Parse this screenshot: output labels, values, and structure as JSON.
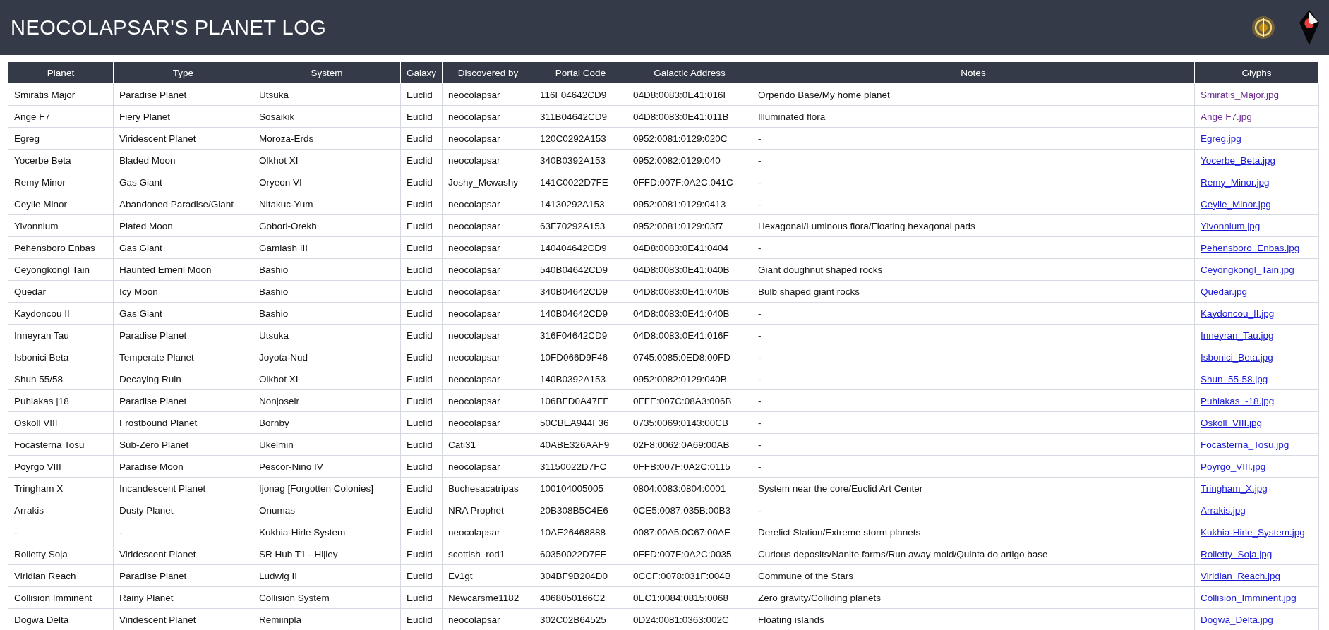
{
  "header": {
    "title": "NEOCOLAPSAR'S PLANET LOG"
  },
  "table": {
    "columns": [
      "Planet",
      "Type",
      "System",
      "Galaxy",
      "Discovered by",
      "Portal Code",
      "Galactic Address",
      "Notes",
      "Glyphs"
    ],
    "rows": [
      {
        "cells": [
          "Smiratis Major",
          "Paradise Planet",
          "Utsuka",
          "Euclid",
          "neocolapsar",
          "116F04642CD9",
          "04D8:0083:0E41:016F",
          "Orpendo Base/My home planet"
        ],
        "glyphs": "Smiratis_Major.jpg",
        "visited": true
      },
      {
        "cells": [
          "Ange F7",
          "Fiery Planet",
          "Sosaikik",
          "Euclid",
          "neocolapsar",
          "311B04642CD9",
          "04D8:0083:0E41:011B",
          "Illuminated flora"
        ],
        "glyphs": "Ange F7.jpg",
        "visited": true
      },
      {
        "cells": [
          "Egreg",
          "Viridescent Planet",
          "Moroza-Erds",
          "Euclid",
          "neocolapsar",
          "120C0292A153",
          "0952:0081:0129:020C",
          "-"
        ],
        "glyphs": "Egreg.jpg",
        "visited": false
      },
      {
        "cells": [
          "Yocerbe Beta",
          "Bladed Moon",
          "Olkhot XI",
          "Euclid",
          "neocolapsar",
          "340B0392A153",
          "0952:0082:0129:040",
          "-"
        ],
        "glyphs": "Yocerbe_Beta.jpg",
        "visited": false
      },
      {
        "cells": [
          "Remy Minor",
          "Gas Giant",
          "Oryeon VI",
          "Euclid",
          "Joshy_Mcwashy",
          "141C0022D7FE",
          "0FFD:007F:0A2C:041C",
          "-"
        ],
        "glyphs": "Remy_Minor.jpg",
        "visited": false
      },
      {
        "cells": [
          "Ceylle Minor",
          "Abandoned Paradise/Giant",
          "Nitakuc-Yum",
          "Euclid",
          "neocolapsar",
          "14130292A153",
          "0952:0081:0129:0413",
          "-"
        ],
        "glyphs": "Ceylle_Minor.jpg",
        "visited": false
      },
      {
        "cells": [
          "Yivonnium",
          "Plated Moon",
          "Gobori-Orekh",
          "Euclid",
          "neocolapsar",
          "63F70292A153",
          "0952:0081:0129:03f7",
          "Hexagonal/Luminous flora/Floating hexagonal pads"
        ],
        "glyphs": "Yivonnium.jpg",
        "visited": false
      },
      {
        "cells": [
          "Pehensboro Enbas",
          "Gas Giant",
          "Gamiash III",
          "Euclid",
          "neocolapsar",
          "140404642CD9",
          "04D8:0083:0E41:0404",
          "-"
        ],
        "glyphs": "Pehensboro_Enbas.jpg",
        "visited": false
      },
      {
        "cells": [
          "Ceyongkongl Tain",
          "Haunted Emeril Moon",
          "Bashio",
          "Euclid",
          "neocolapsar",
          "540B04642CD9",
          "04D8:0083:0E41:040B",
          "Giant doughnut shaped rocks"
        ],
        "glyphs": "Ceyongkongl_Tain.jpg",
        "visited": false
      },
      {
        "cells": [
          "Quedar",
          "Icy Moon",
          "Bashio",
          "Euclid",
          "neocolapsar",
          "340B04642CD9",
          "04D8:0083:0E41:040B",
          "Bulb shaped giant rocks"
        ],
        "glyphs": "Quedar.jpg",
        "visited": false
      },
      {
        "cells": [
          "Kaydoncou II",
          "Gas Giant",
          "Bashio",
          "Euclid",
          "neocolapsar",
          "140B04642CD9",
          "04D8:0083:0E41:040B",
          "-"
        ],
        "glyphs": "Kaydoncou_II.jpg",
        "visited": false
      },
      {
        "cells": [
          "Inneyran Tau",
          "Paradise Planet",
          "Utsuka",
          "Euclid",
          "neocolapsar",
          "316F04642CD9",
          "04D8:0083:0E41:016F",
          "-"
        ],
        "glyphs": "Inneyran_Tau.jpg",
        "visited": false
      },
      {
        "cells": [
          "Isbonici Beta",
          "Temperate Planet",
          "Joyota-Nud",
          "Euclid",
          "neocolapsar",
          "10FD066D9F46",
          "0745:0085:0ED8:00FD",
          "-"
        ],
        "glyphs": "Isbonici_Beta.jpg",
        "visited": false
      },
      {
        "cells": [
          "Shun 55/58",
          "Decaying Ruin",
          "Olkhot XI",
          "Euclid",
          "neocolapsar",
          "140B0392A153",
          "0952:0082:0129:040B",
          "-"
        ],
        "glyphs": "Shun_55-58.jpg",
        "visited": false
      },
      {
        "cells": [
          "Puhiakas |18",
          "Paradise Planet",
          "Nonjoseir",
          "Euclid",
          "neocolapsar",
          "106BFD0A47FF",
          "0FFE:007C:08A3:006B",
          "-"
        ],
        "glyphs": "Puhiakas_-18.jpg",
        "visited": false
      },
      {
        "cells": [
          "Oskoll VIII",
          "Frostbound Planet",
          "Bornby",
          "Euclid",
          "neocolapsar",
          "50CBEA944F36",
          "0735:0069:0143:00CB",
          "-"
        ],
        "glyphs": "Oskoll_VIII.jpg",
        "visited": false
      },
      {
        "cells": [
          "Focasterna Tosu",
          "Sub-Zero Planet",
          "Ukelmin",
          "Euclid",
          "Cati31",
          "40ABE326AAF9",
          "02F8:0062:0A69:00AB",
          "-"
        ],
        "glyphs": "Focasterna_Tosu.jpg",
        "visited": false
      },
      {
        "cells": [
          "Poyrgo VIII",
          "Paradise Moon",
          "Pescor-Nino IV",
          "Euclid",
          "neocolapsar",
          "31150022D7FC",
          "0FFB:007F:0A2C:0115",
          "-"
        ],
        "glyphs": "Poyrgo_VIII.jpg",
        "visited": false
      },
      {
        "cells": [
          "Tringham X",
          "Incandescent Planet",
          "Ijonag [Forgotten Colonies]",
          "Euclid",
          "Buchesacatripas",
          "100104005005",
          "0804:0083:0804:0001",
          "System near the core/Euclid Art Center"
        ],
        "glyphs": "Tringham_X.jpg",
        "visited": false
      },
      {
        "cells": [
          "Arrakis",
          "Dusty Planet",
          "Onumas",
          "Euclid",
          "NRA Prophet",
          "20B308B5C4E6",
          "0CE5:0087:035B:00B3",
          "-"
        ],
        "glyphs": "Arrakis.jpg",
        "visited": false
      },
      {
        "cells": [
          "-",
          "-",
          "Kukhia-Hirle System",
          "Euclid",
          "neocolapsar",
          "10AE26468888",
          "0087:00A5:0C67:00AE",
          "Derelict Station/Extreme storm planets"
        ],
        "glyphs": "Kukhia-Hirle_System.jpg",
        "visited": false
      },
      {
        "cells": [
          "Rolietty Soja",
          "Viridescent Planet",
          "SR Hub T1 - Hijiey",
          "Euclid",
          "scottish_rod1",
          "60350022D7FE",
          "0FFD:007F:0A2C:0035",
          "Curious deposits/Nanite farms/Run away mold/Quinta do artigo base"
        ],
        "glyphs": "Rolietty_Soja.jpg",
        "visited": false
      },
      {
        "cells": [
          "Viridian Reach",
          "Paradise Planet",
          "Ludwig II",
          "Euclid",
          "Ev1gt_",
          "304BF9B204D0",
          "0CCF:0078:031F:004B",
          "Commune of the Stars"
        ],
        "glyphs": "Viridian_Reach.jpg",
        "visited": false
      },
      {
        "cells": [
          "Collision Imminent",
          "Rainy Planet",
          "Collision System",
          "Euclid",
          "Newcarsme1182",
          "4068050166C2",
          "0EC1:0084:0815:0068",
          "Zero gravity/Colliding planets"
        ],
        "glyphs": "Collision_Imminent.jpg",
        "visited": false
      },
      {
        "cells": [
          "Dogwa Delta",
          "Viridescent Planet",
          "Remiinpla",
          "Euclid",
          "neocolapsar",
          "302C02B64525",
          "0D24:0081:0363:002C",
          "Floating islands"
        ],
        "glyphs": "Dogwa_Delta.jpg",
        "visited": false
      }
    ]
  }
}
